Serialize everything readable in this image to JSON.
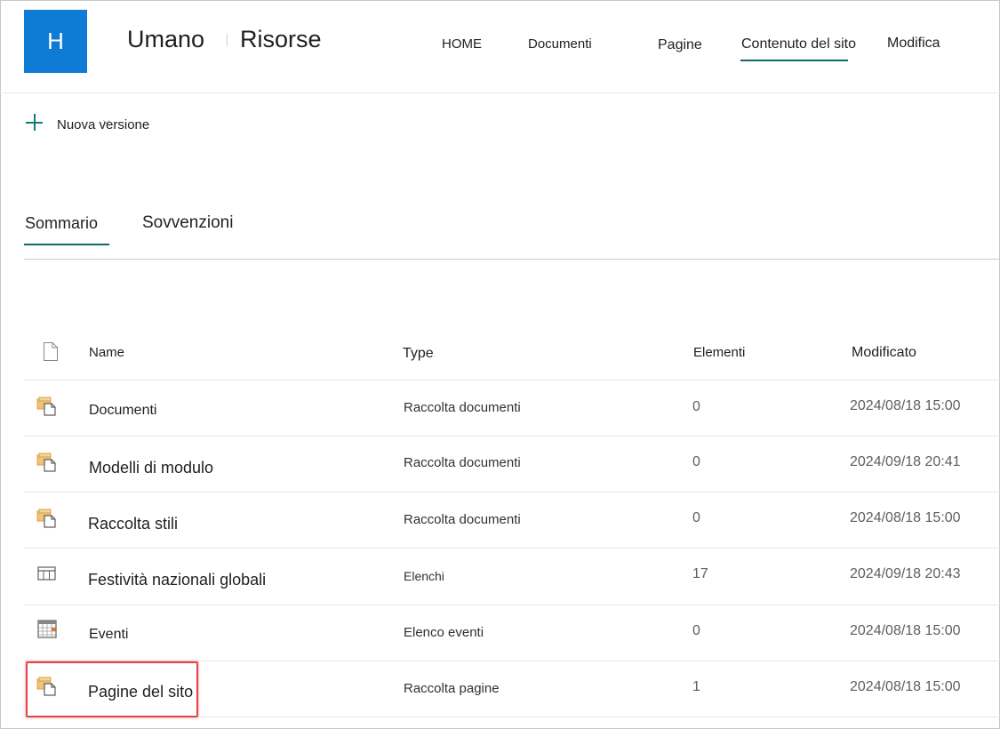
{
  "header": {
    "logo_letter": "H",
    "title_part1": "Umano",
    "title_part2": "Risorse",
    "nav": [
      "HOME",
      "Documenti",
      "Pagine",
      "Contenuto del sito",
      "Modifica"
    ],
    "active_nav": "Contenuto del sito"
  },
  "command_bar": {
    "new_label": "Nuova versione",
    "new_icon": "plus-icon"
  },
  "tabs": {
    "items": [
      "Sommario",
      "Sovvenzioni"
    ],
    "active": "Sommario"
  },
  "table": {
    "columns": [
      "Name",
      "Type",
      "Elementi",
      "Modificato"
    ],
    "rows": [
      {
        "icon": "document-library-icon",
        "name": "Documenti",
        "type": "Raccolta documenti",
        "items": "0",
        "modified": "2024/08/18 15:00"
      },
      {
        "icon": "document-library-icon",
        "name": "Modelli di modulo",
        "type": "Raccolta documenti",
        "items": "0",
        "modified": "2024/09/18 20:41"
      },
      {
        "icon": "document-library-icon",
        "name": "Raccolta stili",
        "type": "Raccolta documenti",
        "items": "0",
        "modified": "2024/08/18 15:00"
      },
      {
        "icon": "list-icon",
        "name": "Festività nazionali globali",
        "type": "Elenchi",
        "items": "17",
        "modified": "2024/09/18 20:43"
      },
      {
        "icon": "calendar-icon",
        "name": "Eventi",
        "type": "Elenco eventi",
        "items": "0",
        "modified": "2024/08/18 15:00"
      },
      {
        "icon": "document-library-icon",
        "name": "Pagine del sito",
        "type": "Raccolta pagine",
        "items": "1",
        "modified": "2024/08/18 15:00"
      }
    ],
    "highlighted_row": "Pagine del sito"
  },
  "colors": {
    "logo_bg": "#0f7bd4",
    "accent": "#0b6a6a",
    "highlight": "#e0454b"
  }
}
